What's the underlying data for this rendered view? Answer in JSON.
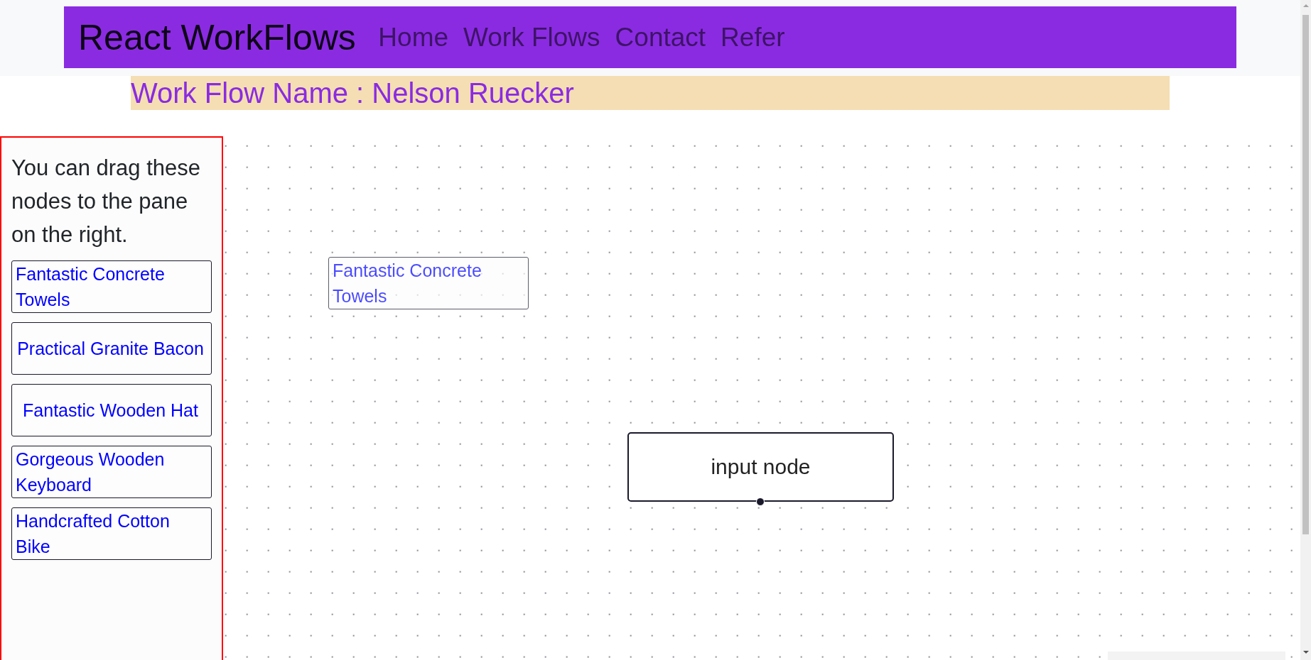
{
  "navbar": {
    "brand": "React WorkFlows",
    "links": [
      "Home",
      "Work Flows",
      "Contact",
      "Refer"
    ]
  },
  "workflow_title": "Work Flow Name : Nelson Ruecker",
  "sidebar": {
    "description": "You can drag these nodes to the pane on the right.",
    "nodes": [
      "Fantastic Concrete Towels",
      "Practical Granite Bacon",
      "Fantastic Wooden Hat",
      "Gorgeous Wooden Keyboard",
      "Handcrafted Cotton Bike"
    ]
  },
  "canvas": {
    "nodes": [
      {
        "kind": "default",
        "label": "Fantastic Concrete Towels",
        "dragging": true
      },
      {
        "kind": "input",
        "label": "input node",
        "dragging": false
      }
    ]
  }
}
